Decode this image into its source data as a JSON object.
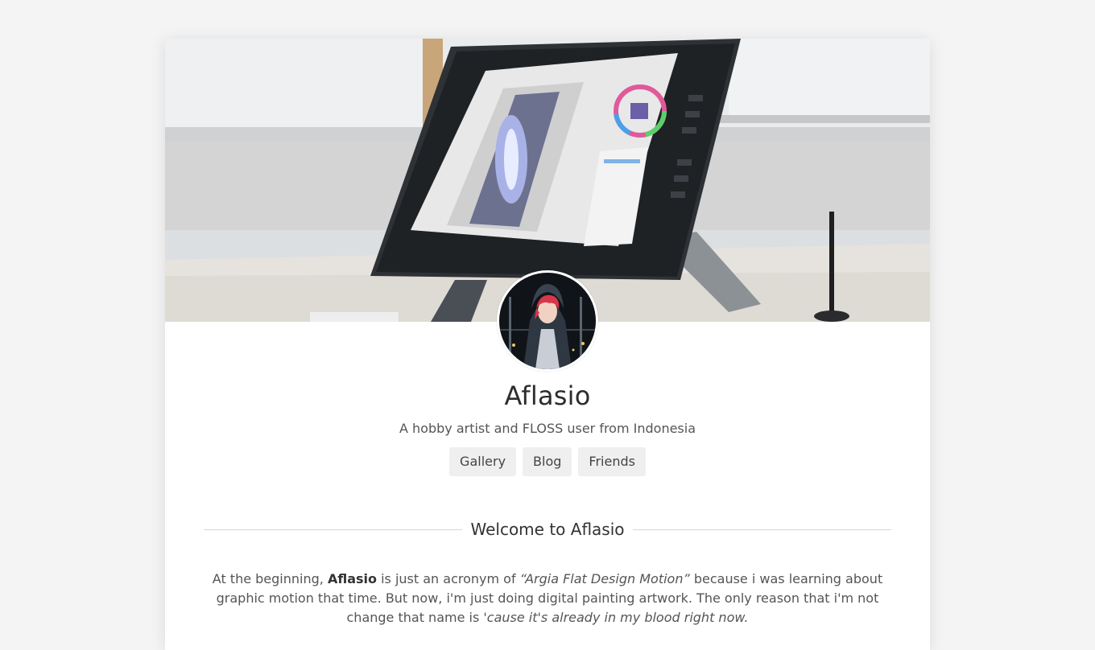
{
  "profile": {
    "name": "Aflasio",
    "tagline": "A hobby artist and FLOSS user from Indonesia",
    "banner_image": "drawing-tablet-photo",
    "avatar_image": "red-haired-hooded-character-avatar"
  },
  "nav": {
    "items": [
      {
        "label": "Gallery"
      },
      {
        "label": "Blog"
      },
      {
        "label": "Friends"
      }
    ]
  },
  "welcome": {
    "title": "Welcome to Aflasio",
    "p_start": "At the beginning, ",
    "p_name": "Aflasio",
    "p_mid1": " is just an acronym of ",
    "p_quote": "“Argia Flat Design Motion”",
    "p_mid2": " because i was learning about graphic motion that time. But now, i'm just doing digital painting artwork. The only reason that i'm not change that name is ",
    "p_end": "'cause it's already in my blood right now."
  },
  "colors": {
    "page_bg": "#f4f4f4",
    "card_bg": "#ffffff",
    "button_bg": "#efefef",
    "text_dark": "#333333",
    "text_muted": "#555555"
  }
}
